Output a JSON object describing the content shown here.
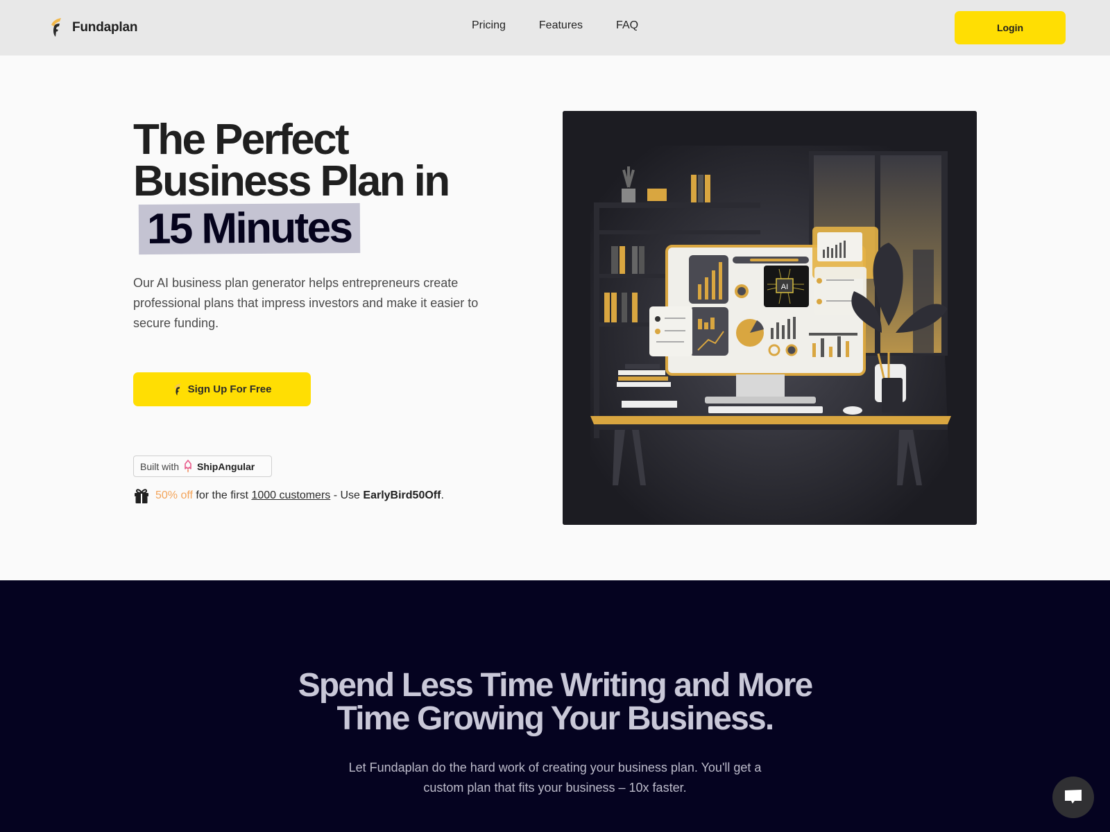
{
  "nav": {
    "logo_text": "Fundaplan",
    "links": [
      "Pricing",
      "Features",
      "FAQ"
    ],
    "login_label": "Login"
  },
  "hero": {
    "title_line1": "The Perfect",
    "title_line2": "Business Plan in",
    "title_highlight": "15 Minutes",
    "description": "Our AI business plan generator helps entrepreneurs create professional plans that impress investors and make it easier to secure funding.",
    "cta_label": "Sign Up For Free",
    "badge": {
      "prefix": "Built with",
      "brand": "ShipAngular"
    },
    "promo": {
      "discount": "50% off",
      "text1": " for the first ",
      "link": "1000 customers",
      "text2": " - Use ",
      "code": "EarlyBird50Off",
      "suffix": "."
    },
    "illustration": {
      "screen_label": "AI"
    }
  },
  "section2": {
    "title_line1": "Spend Less Time Writing and More",
    "title_line2": "Time Growing Your Business.",
    "subtitle": "Let Fundaplan do the hard work of creating your business plan. You'll get a custom plan that fits your business – 10x faster."
  },
  "colors": {
    "accent": "#ffde03",
    "nav_bg": "#e8e8e8",
    "dark_bg": "#050320",
    "highlight_bg": "#c4c3d2",
    "promo_orange": "#f3a45a"
  }
}
